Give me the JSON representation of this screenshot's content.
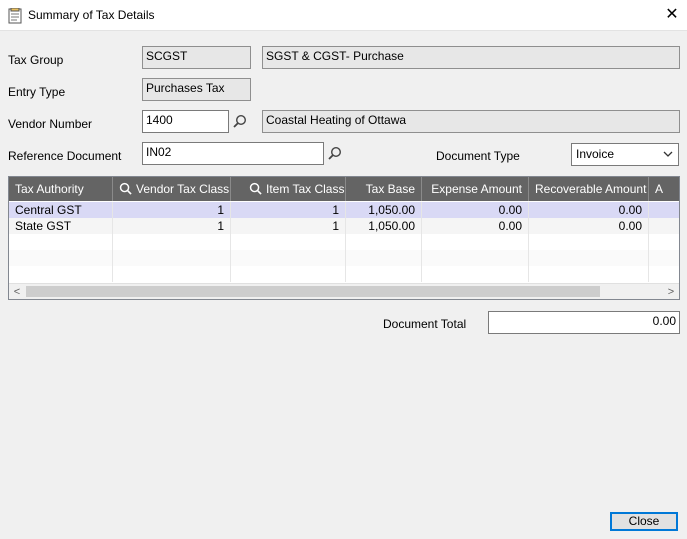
{
  "window": {
    "title": "Summary of Tax Details",
    "close_glyph": "✕"
  },
  "form": {
    "tax_group": {
      "label": "Tax Group",
      "code": "SCGST",
      "description": "SGST & CGST- Purchase"
    },
    "entry_type": {
      "label": "Entry Type",
      "value": "Purchases Tax"
    },
    "vendor_number": {
      "label": "Vendor Number",
      "value": "1400",
      "name": "Coastal Heating of Ottawa"
    },
    "reference_document": {
      "label": "Reference Document",
      "value": "IN02"
    },
    "document_type": {
      "label": "Document Type",
      "value": "Invoice"
    }
  },
  "grid": {
    "columns": [
      "Tax Authority",
      "Vendor Tax Class",
      "Item Tax Class",
      "Tax Base",
      "Expense Amount",
      "Recoverable Amount",
      "A"
    ],
    "rows": [
      {
        "authority": "Central GST",
        "vendor_class": "1",
        "item_class": "1",
        "tax_base": "1,050.00",
        "expense": "0.00",
        "recoverable": "0.00"
      },
      {
        "authority": "State GST",
        "vendor_class": "1",
        "item_class": "1",
        "tax_base": "1,050.00",
        "expense": "0.00",
        "recoverable": "0.00"
      }
    ],
    "selected_row": 0,
    "scroll_left": "<",
    "scroll_right": ">"
  },
  "totals": {
    "label": "Document Total",
    "value": "0.00"
  },
  "buttons": {
    "close": "Close"
  },
  "colors": {
    "header_bg": "#646464",
    "selected_row": "#d9d9f5",
    "focus": "#0078d7"
  },
  "icons": {
    "title": "document-icon",
    "finder": "magnifier-icon",
    "dropdown": "chevron-down-icon"
  }
}
